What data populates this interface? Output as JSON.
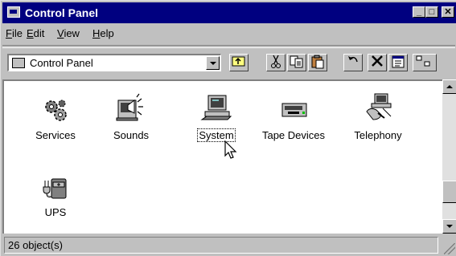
{
  "window": {
    "title": "Control Panel"
  },
  "title_buttons": {
    "minimize": "_",
    "maximize": "□",
    "close": "✕"
  },
  "menus": [
    {
      "pre": "",
      "key": "F",
      "post": "ile"
    },
    {
      "pre": "",
      "key": "E",
      "post": "dit"
    },
    {
      "pre": "",
      "key": "V",
      "post": "iew"
    },
    {
      "pre": "",
      "key": "H",
      "post": "elp"
    }
  ],
  "address": {
    "value": "Control Panel"
  },
  "toolbar_icons": [
    "up-one-level-icon",
    "cut-icon",
    "copy-icon",
    "paste-icon",
    "undo-icon",
    "delete-icon",
    "properties-icon",
    "large-icons-view-icon"
  ],
  "items": [
    {
      "label": "Services",
      "icon": "services-gears-icon"
    },
    {
      "label": "Sounds",
      "icon": "sounds-speaker-icon"
    },
    {
      "label": "System",
      "icon": "system-computer-icon",
      "selected": true
    },
    {
      "label": "Tape Devices",
      "icon": "tape-drive-icon"
    },
    {
      "label": "Telephony",
      "icon": "telephony-icon"
    },
    {
      "label": "UPS",
      "icon": "ups-battery-icon"
    }
  ],
  "status": {
    "text": "26 object(s)"
  }
}
